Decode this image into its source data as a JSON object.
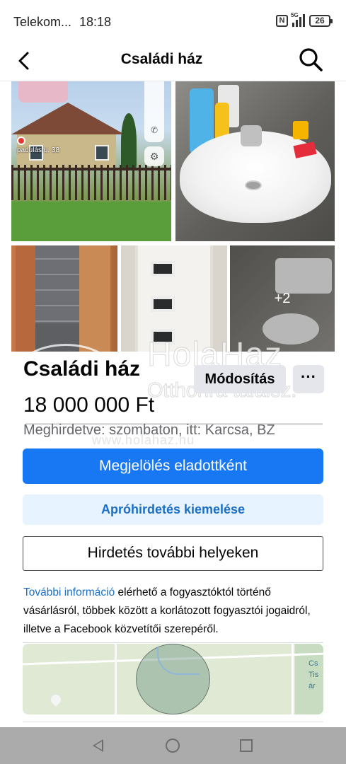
{
  "status_bar": {
    "carrier": "Telekom...",
    "time": "18:18",
    "network": "5G",
    "battery": "26"
  },
  "header": {
    "title": "Családi ház"
  },
  "photos": {
    "street_label": "padulás u. 38",
    "more_count": "+2"
  },
  "watermark": {
    "brand": "HolaHaz",
    "tagline": "Otthonra találsz.",
    "url": "www.holahaz.hu"
  },
  "listing": {
    "title": "Családi ház",
    "price": "18 000 000 Ft",
    "posted": "Meghirdetve: szombaton, itt: Karcsa, BZ",
    "edit_label": "Módosítás",
    "more_label": "···"
  },
  "actions": {
    "mark_sold": "Megjelölés eladottként",
    "promote": "Apróhirdetés kiemelése",
    "list_elsewhere": "Hirdetés további helyeken"
  },
  "info": {
    "link_text": "További információ",
    "rest_text": " elérhető a fogyasztóktól történő vásárlásról, többek között a korlátozott fogyasztói jogaidról, illetve a Facebook közvetítői szerepéről."
  },
  "map": {
    "place_label": "Cs Tis ár"
  },
  "colors": {
    "primary": "#1877f2",
    "secondary_bg": "#e7f3ff",
    "link": "#1b6fc6",
    "muted_text": "#65676b"
  }
}
